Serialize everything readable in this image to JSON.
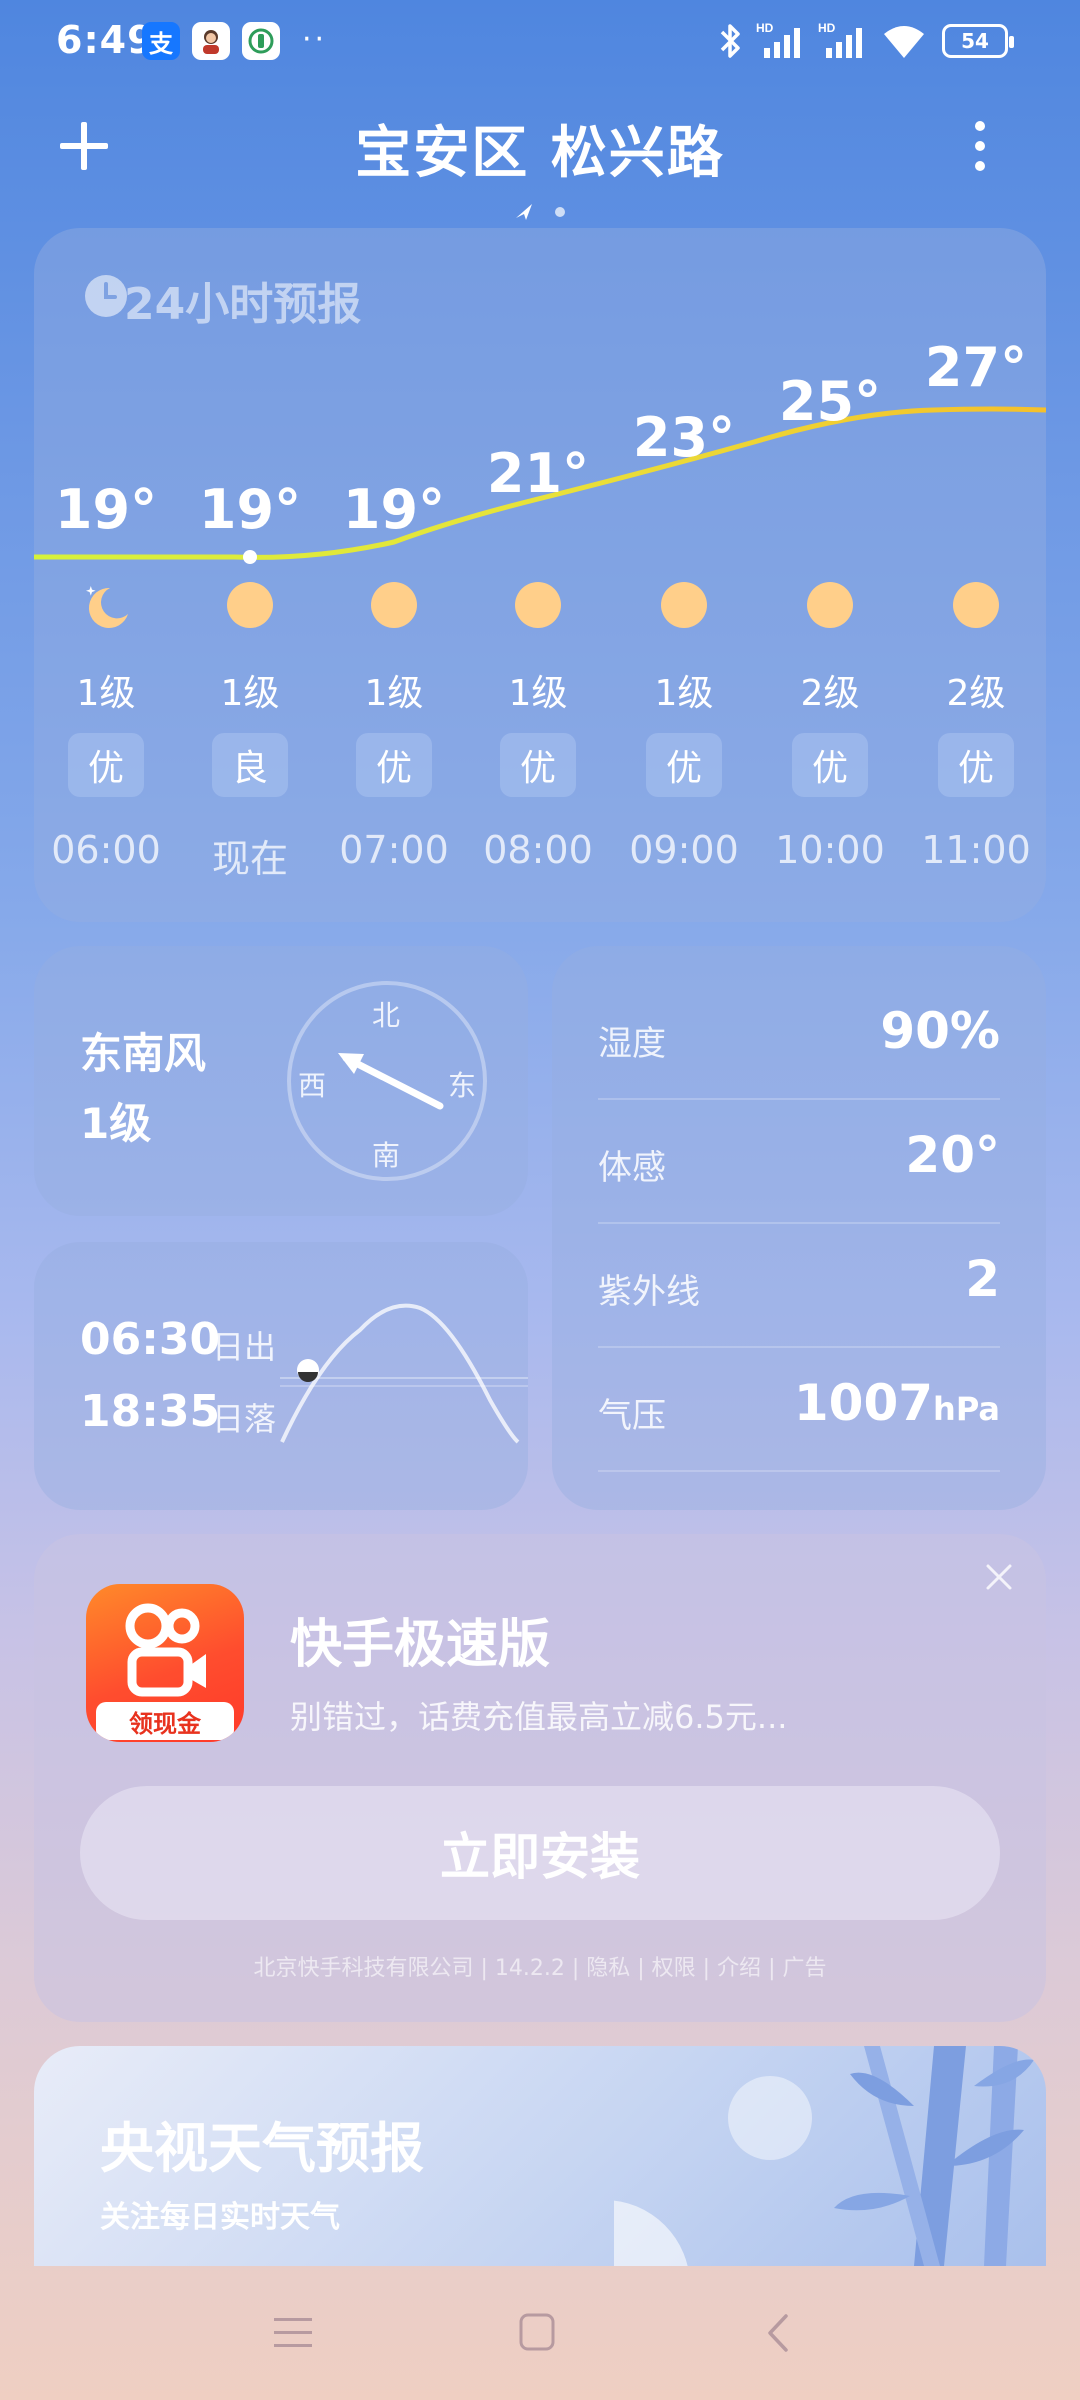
{
  "status_bar": {
    "time": "6:49",
    "battery": "54",
    "app_icons": [
      "alipay-icon",
      "avatar-icon",
      "app-icon"
    ],
    "signal": [
      "bluetooth-icon",
      "hd-signal-icon",
      "hd-signal-icon",
      "wifi-icon"
    ],
    "hd": "HD"
  },
  "header": {
    "location": "宝安区 松兴路",
    "add_icon": "plus-icon",
    "more_icon": "more-vertical-icon"
  },
  "hourly": {
    "title": "24小时预报",
    "items": [
      {
        "temp": "19°",
        "icon": "moon-icon",
        "wind": "1级",
        "aq": "优",
        "hour": "06:00"
      },
      {
        "temp": "19°",
        "icon": "sun-icon",
        "wind": "1级",
        "aq": "良",
        "hour": "现在"
      },
      {
        "temp": "19°",
        "icon": "sun-icon",
        "wind": "1级",
        "aq": "优",
        "hour": "07:00"
      },
      {
        "temp": "21°",
        "icon": "sun-icon",
        "wind": "1级",
        "aq": "优",
        "hour": "08:00"
      },
      {
        "temp": "23°",
        "icon": "sun-icon",
        "wind": "1级",
        "aq": "优",
        "hour": "09:00"
      },
      {
        "temp": "25°",
        "icon": "sun-icon",
        "wind": "2级",
        "aq": "优",
        "hour": "10:00"
      },
      {
        "temp": "27°",
        "icon": "sun-icon",
        "wind": "2级",
        "aq": "优",
        "hour": "11:00"
      }
    ]
  },
  "wind": {
    "direction": "东南风",
    "level": "1级",
    "compass": {
      "n": "北",
      "s": "南",
      "e": "东",
      "w": "西"
    }
  },
  "sun": {
    "sunrise_time": "06:30",
    "sunrise_label": "日出",
    "sunset_time": "18:35",
    "sunset_label": "日落"
  },
  "details": [
    {
      "label": "湿度",
      "value": "90%"
    },
    {
      "label": "体感",
      "value": "20°"
    },
    {
      "label": "紫外线",
      "value": "2"
    },
    {
      "label": "气压",
      "value": "1007",
      "unit": "hPa"
    }
  ],
  "ad": {
    "app_name": "快手极速版",
    "desc": "别错过，话费充值最高立减6.5元...",
    "icon_badge": "领现金",
    "install": "立即安装",
    "footer": "北京快手科技有限公司 | 14.2.2 | 隐私 | 权限 | 介绍 | 广告"
  },
  "cctv": {
    "title": "央视天气预报",
    "subtitle": "关注每日实时天气"
  },
  "colors": {
    "accent_line": "#f5c02b",
    "sun": "#ffcf8a",
    "ad_orange": "#ff4d2e"
  }
}
